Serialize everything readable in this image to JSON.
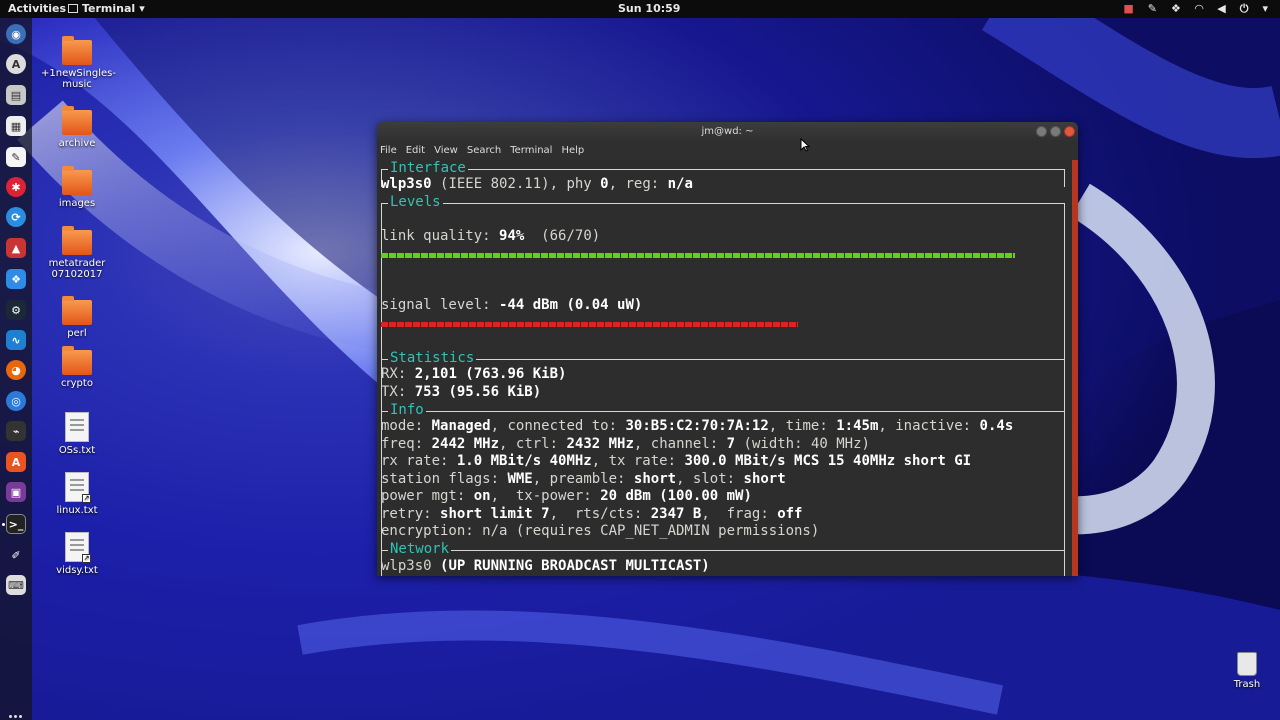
{
  "topbar": {
    "activities": "Activities",
    "app_name": "Terminal",
    "clock": "Sun 10:59"
  },
  "desktop": {
    "icons": [
      {
        "label": "+1newSingles-music",
        "kind": "folder"
      },
      {
        "label": "archive",
        "kind": "folder"
      },
      {
        "label": "images",
        "kind": "folder"
      },
      {
        "label": "metatrader 07102017",
        "kind": "folder"
      },
      {
        "label": "perl",
        "kind": "folder"
      },
      {
        "label": "crypto",
        "kind": "folder"
      },
      {
        "label": "OSs.txt",
        "kind": "text-file"
      },
      {
        "label": "linux.txt",
        "kind": "text-link"
      },
      {
        "label": "vidsy.txt",
        "kind": "text-link"
      }
    ],
    "trash_label": "Trash"
  },
  "window": {
    "title": "jm@wd: ~",
    "menu": [
      "File",
      "Edit",
      "View",
      "Search",
      "Terminal",
      "Help"
    ]
  },
  "wavemon": {
    "interface": {
      "title": "Interface",
      "name": "wlp3s0",
      "standard": "(IEEE 802.11), phy",
      "phy": "0",
      "reg_label": ", reg:",
      "reg": "n/a"
    },
    "levels": {
      "title": "Levels",
      "link_quality_label": "link quality:",
      "link_quality": "94%",
      "link_quality_ratio": "(66/70)",
      "link_quality_fraction": 0.943,
      "signal_label": "signal level:",
      "signal": "-44 dBm (0.04 uW)",
      "signal_fraction": 0.62
    },
    "statistics": {
      "title": "Statistics",
      "rx_label": "RX:",
      "rx": "2,101 (763.96 KiB)",
      "tx_label": "TX:",
      "tx": "753 (95.56 KiB)"
    },
    "info": {
      "title": "Info",
      "mode_label": "mode:",
      "mode": "Managed",
      "connected_label": ", connected to:",
      "bssid": "30:B5:C2:70:7A:12",
      "time_label": ", time:",
      "time": "1:45m",
      "inactive_label": ", inactive:",
      "inactive": "0.4s",
      "freq_label": "freq:",
      "freq": "2442 MHz",
      "ctrl_label": ", ctrl:",
      "ctrl": "2432 MHz",
      "channel_label": ", channel:",
      "channel": "7",
      "width": "(width: 40 MHz)",
      "rx_rate_label": "rx rate:",
      "rx_rate": "1.0 MBit/s 40MHz",
      "tx_rate_label": ", tx rate:",
      "tx_rate": "300.0 MBit/s MCS 15 40MHz short GI",
      "flags_label": "station flags:",
      "flags": "WME",
      "preamble_label": ", preamble:",
      "preamble": "short",
      "slot_label": ", slot:",
      "slot": "short",
      "power_label": "power mgt:",
      "power": "on",
      "txpower_label": ",  tx-power:",
      "txpower": "20 dBm (100.00 mW)",
      "retry_label": "retry:",
      "retry": "short limit 7",
      "rts_label": ",  rts/cts:",
      "rts": "2347 B",
      "frag_label": ",  frag:",
      "frag": "off",
      "encryption": "encryption: n/a (requires CAP_NET_ADMIN permissions)"
    },
    "network": {
      "title": "Network",
      "name": "wlp3s0",
      "flags": "(UP RUNNING BROADCAST MULTICAST)"
    }
  }
}
